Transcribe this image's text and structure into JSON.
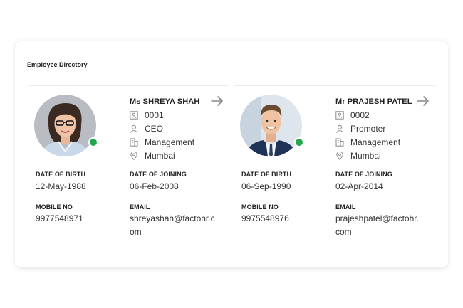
{
  "panel": {
    "title": "Employee Directory"
  },
  "labels": {
    "dob": "DATE OF BIRTH",
    "doj": "DATE OF JOINING",
    "mobile": "MOBILE NO",
    "email": "EMAIL"
  },
  "colors": {
    "online": "#22a84a",
    "icon": "#8a8a8a"
  },
  "employees": [
    {
      "name": "Ms SHREYA SHAH",
      "id": "0001",
      "designation": "CEO",
      "department": "Management",
      "location": "Mumbai",
      "dob": "12-May-1988",
      "doj": "06-Feb-2008",
      "mobile": "9977548971",
      "email": "shreyashah@factohr.com",
      "status": "online"
    },
    {
      "name": "Mr PRAJESH PATEL",
      "id": "0002",
      "designation": "Promoter",
      "department": "Management",
      "location": "Mumbai",
      "dob": "06-Sep-1990",
      "doj": "02-Apr-2014",
      "mobile": "9975548976",
      "email": "prajeshpatel@factohr.com",
      "status": "online"
    }
  ]
}
